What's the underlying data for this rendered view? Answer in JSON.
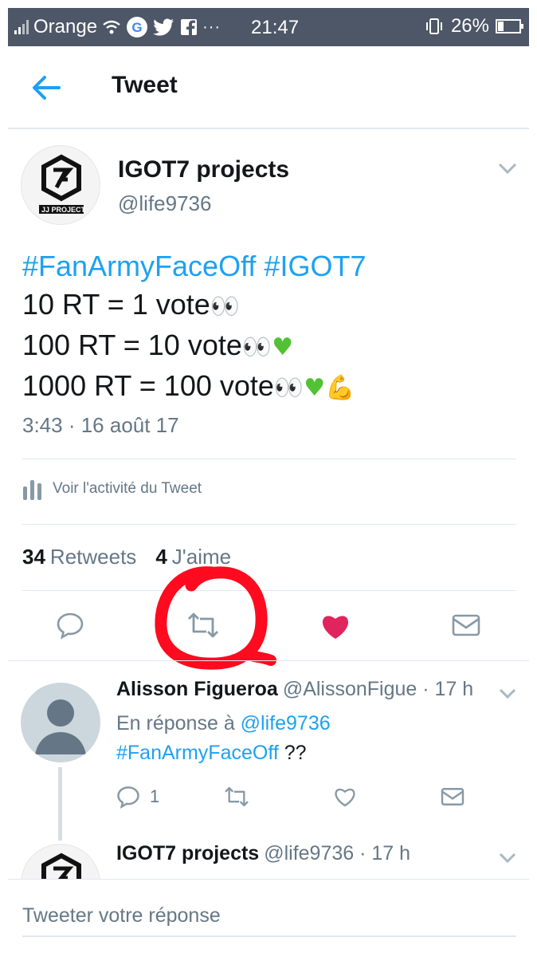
{
  "status_bar": {
    "carrier": "Orange",
    "time": "21:47",
    "battery": "26%",
    "battery_level": 0.26
  },
  "header": {
    "title": "Tweet"
  },
  "tweet": {
    "author_name": "IGOT7 projects",
    "author_handle": "@life9736",
    "avatar_caption": "JJ PROJECT",
    "hashtags": "#FanArmyFaceOff #IGOT7",
    "lines": [
      "10 RT = 1 vote",
      "100 RT = 10 vote",
      "1000 RT = 100 vote"
    ],
    "timestamp": "3:43 · 16 août 17",
    "activity_label": "Voir l'activité du Tweet",
    "retweets_count": "34",
    "retweets_label": "Retweets",
    "likes_count": "4",
    "likes_label": "J'aime"
  },
  "replies": [
    {
      "name": "Alisson Figueroa",
      "handle": "@AlissonFigue · 17 h",
      "reply_prefix": "En réponse à",
      "reply_to": "@life9736",
      "text_tag": "#FanArmyFaceOff",
      "text_rest": " ??",
      "reply_count": "1"
    },
    {
      "name": "IGOT7 projects",
      "handle": "@life9736 · 17 h"
    }
  ],
  "compose": {
    "placeholder": "Tweeter votre réponse"
  },
  "colors": {
    "accent": "#1da1f2",
    "like": "#e0245e",
    "annotation": "#ff0000"
  }
}
